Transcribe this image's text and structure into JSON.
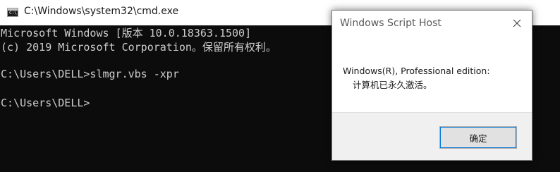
{
  "cmd_window": {
    "title": "C:\\Windows\\system32\\cmd.exe",
    "icon_glyph": "C:\\",
    "console_lines": [
      "Microsoft Windows [版本 10.0.18363.1500]",
      "(c) 2019 Microsoft Corporation。保留所有权利。",
      "C:\\Users\\DELL>slmgr.vbs -xpr",
      "C:\\Users\\DELL>"
    ],
    "colors": {
      "background": "#0c0c0c",
      "text": "#cccccc",
      "titlebar": "#ffffff"
    }
  },
  "dialog": {
    "title": "Windows Script Host",
    "message_line1": "Windows(R), Professional edition:",
    "message_line2": "计算机已永久激活。",
    "ok_label": "确定",
    "colors": {
      "footer": "#f0f0f0",
      "button_focus": "#0078d7"
    }
  }
}
